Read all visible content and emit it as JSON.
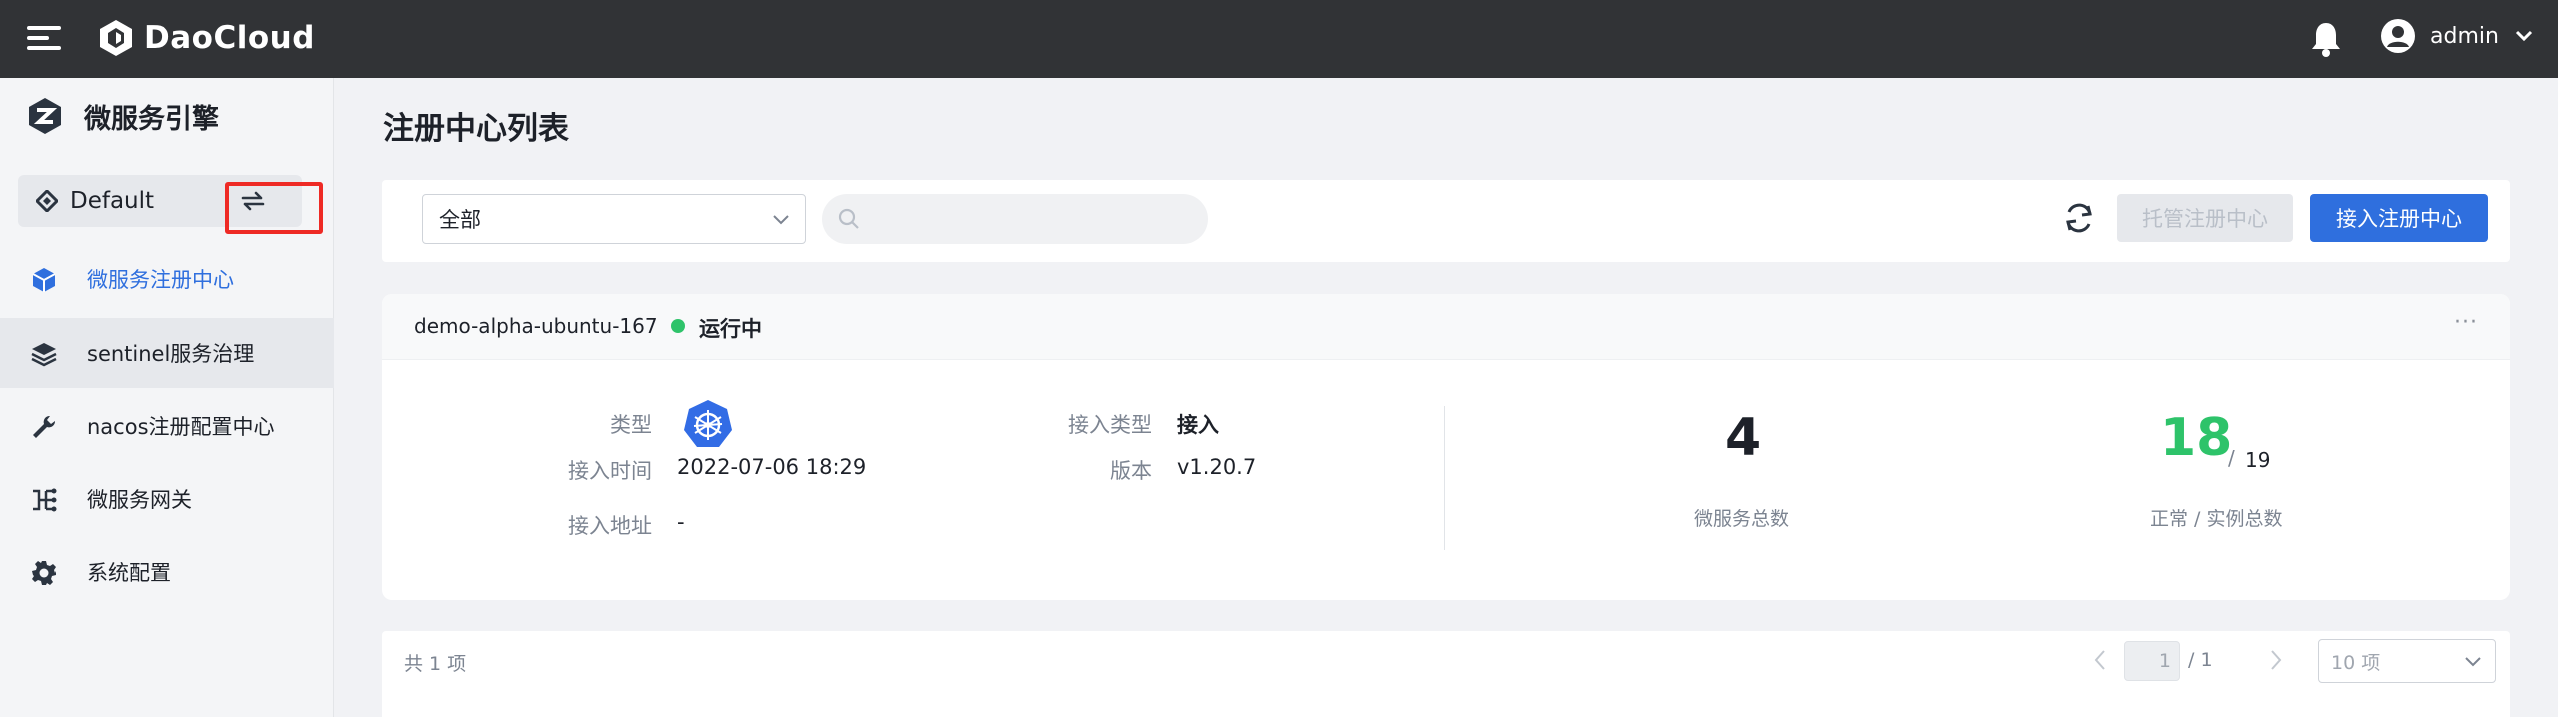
{
  "header": {
    "brand": "DaoCloud",
    "user": "admin"
  },
  "sidebar": {
    "product_title": "微服务引擎",
    "workspace": "Default",
    "items": [
      {
        "label": "微服务注册中心",
        "icon": "cube-icon",
        "active": true
      },
      {
        "label": "sentinel服务治理",
        "icon": "layers-icon"
      },
      {
        "label": "nacos注册配置中心",
        "icon": "wrench-icon"
      },
      {
        "label": "微服务网关",
        "icon": "gateway-icon"
      },
      {
        "label": "系统配置",
        "icon": "gear-icon"
      }
    ]
  },
  "main": {
    "title": "注册中心列表",
    "filter": {
      "value": "全部",
      "search_placeholder": ""
    },
    "buttons": {
      "hosted": "托管注册中心",
      "access": "接入注册中心"
    },
    "card": {
      "name": "demo-alpha-ubuntu-167",
      "status": "运行中",
      "status_color": "#2ec36a",
      "fields": {
        "type_label": "类型",
        "access_time_label": "接入时间",
        "access_time": "2022-07-06 18:29",
        "address_label": "接入地址",
        "address": "-",
        "access_type_label": "接入类型",
        "access_type": "接入",
        "version_label": "版本",
        "version": "v1.20.7"
      },
      "stats": {
        "services_total": "4",
        "services_label": "微服务总数",
        "instances_normal": "18",
        "instances_sep": "/",
        "instances_total": "19",
        "instances_label": "正常 / 实例总数"
      }
    },
    "pager": {
      "total": "共 1 项",
      "current": "1",
      "of": "/ 1",
      "page_size": "10 项"
    }
  },
  "colors": {
    "primary": "#2f6fde",
    "topbar": "#313336",
    "highlight_box": "#ee2a25"
  }
}
